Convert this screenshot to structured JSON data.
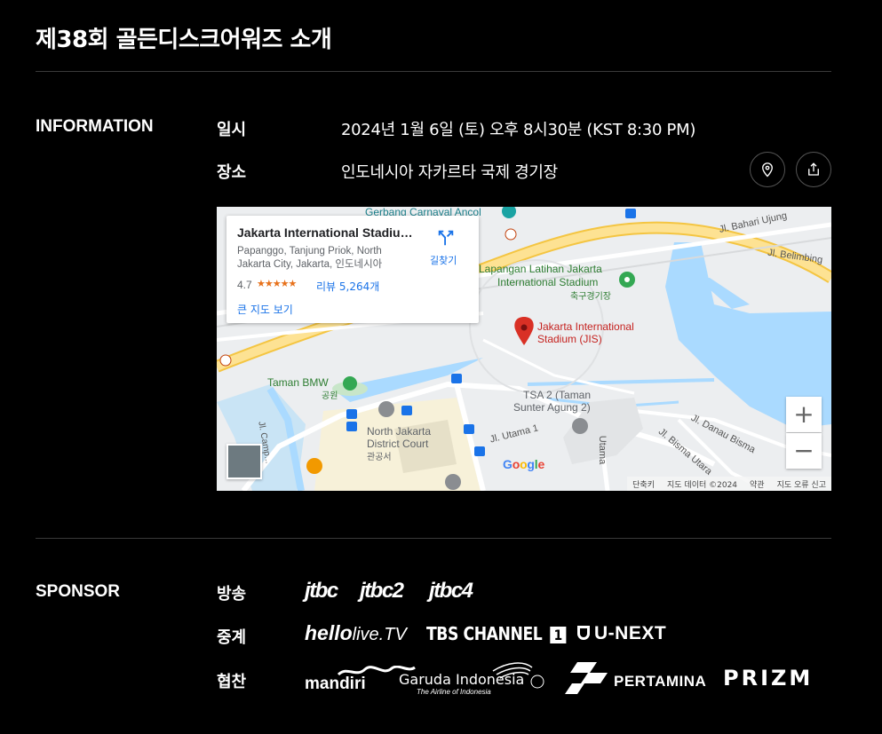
{
  "page": {
    "title": "제38회 골든디스크어워즈 소개"
  },
  "information": {
    "heading": "INFORMATION",
    "date_label": "일시",
    "date_value": "2024년 1월 6일 (토) 오후 8시30분 (KST 8:30 PM)",
    "venue_label": "장소",
    "venue_value": "인도네시아 자카르타 국제 경기장",
    "location_icon": "map-pin-icon",
    "share_icon": "share-icon"
  },
  "map": {
    "card": {
      "name": "Jakarta International Stadium ...",
      "address": "Papanggo, Tanjung Priok, North Jakarta City, Jakarta, 인도네시아",
      "rating": "4.7",
      "stars": "★★★★★",
      "reviews": "리뷰 5,264개",
      "larger_map": "큰 지도 보기",
      "directions": "길찾기"
    },
    "labels": {
      "gerbang": "Gerbang Carnaval Ancol",
      "bahari": "Jl. Bahari Ujung",
      "belimbing": "Jl. Belimbing",
      "lapangan": "Lapangan Latihan Jakarta",
      "intl_stadium": "International Stadium",
      "training_ko": "축구경기장",
      "jis1": "Jakarta International",
      "jis2": "Stadium (JIS)",
      "taman_bmw": "Taman BMW",
      "park_ko": "공원",
      "tsa1": "TSA 2 (Taman",
      "tsa2": "Sunter Agung 2)",
      "court1": "North Jakarta",
      "court2": "District Court",
      "court_ko": "관공서",
      "utama1": "Jl. Utama 1",
      "utama": "Utama",
      "danau": "Jl. Danau Bisma",
      "bisma": "Jl. Bisma Utara",
      "camp": "Jl. Camp..."
    },
    "zoom_in": "+",
    "zoom_out": "−",
    "google": [
      "G",
      "o",
      "o",
      "g",
      "l",
      "e"
    ],
    "google_colors": [
      "#4285F4",
      "#EA4335",
      "#FBBC05",
      "#4285F4",
      "#34A853",
      "#EA4335"
    ],
    "attribution": {
      "shortcuts": "단축키",
      "data": "지도 데이터 ©2024",
      "terms": "약관",
      "report": "지도 오류 신고"
    }
  },
  "sponsor": {
    "heading": "SPONSOR",
    "broadcast_label": "방송",
    "broadcast_logos": [
      "jtbc",
      "jtbc2",
      "jtbc4"
    ],
    "relay_label": "중계",
    "relay_logos": {
      "hello1": "hello",
      "hello2": "live.TV",
      "tbs": "TBS CHANNEL",
      "tbs_num": "1",
      "unext": "U-NEXT"
    },
    "sponsor_label": "협찬",
    "sponsor_logos": {
      "mandiri": "mandiri",
      "garuda": "Garuda Indonesia",
      "garuda_tag": "The Airline of Indonesia",
      "pertamina": "PERTAMINA",
      "prizm": "PRIZM"
    }
  },
  "colors": {
    "accent_red": "#d93025",
    "map_blue": "#1a73e8",
    "water": "#aadaff",
    "road_yellow": "#fde293"
  }
}
